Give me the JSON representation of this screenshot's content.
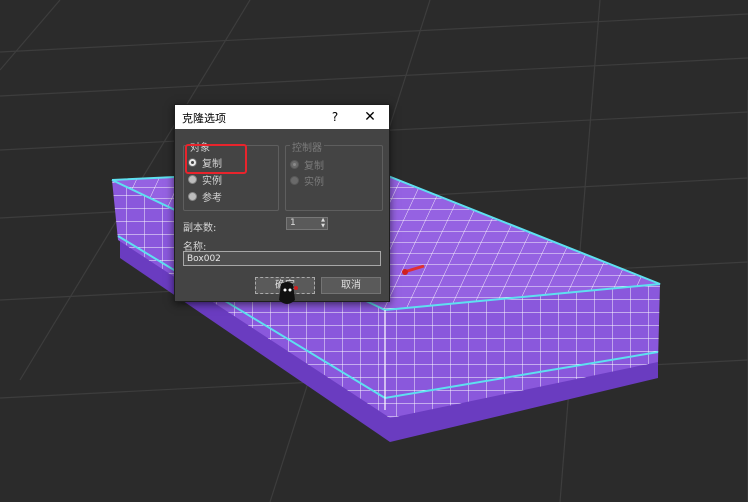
{
  "dialog": {
    "title": "克隆选项",
    "help_label": "?",
    "close_label": "✕",
    "object_group": {
      "title": "对象",
      "options": [
        {
          "label": "复制",
          "checked": true
        },
        {
          "label": "实例",
          "checked": false
        },
        {
          "label": "参考",
          "checked": false
        }
      ]
    },
    "controller_group": {
      "title": "控制器",
      "options": [
        {
          "label": "复制",
          "checked": true
        },
        {
          "label": "实例",
          "checked": false
        }
      ]
    },
    "copies": {
      "label": "副本数:",
      "value": "1"
    },
    "name": {
      "label": "名称:",
      "value": "Box002"
    },
    "ok_label": "确定",
    "cancel_label": "取消"
  },
  "colors": {
    "viewport_bg": "#2b2b2b",
    "grid": "#3d3d3d",
    "box_face": "#8c5cd6",
    "box_side": "#7a4cc4",
    "box_outline": "#5ee0f0",
    "highlight": "#e8242c",
    "dialog_bg": "#444444"
  }
}
